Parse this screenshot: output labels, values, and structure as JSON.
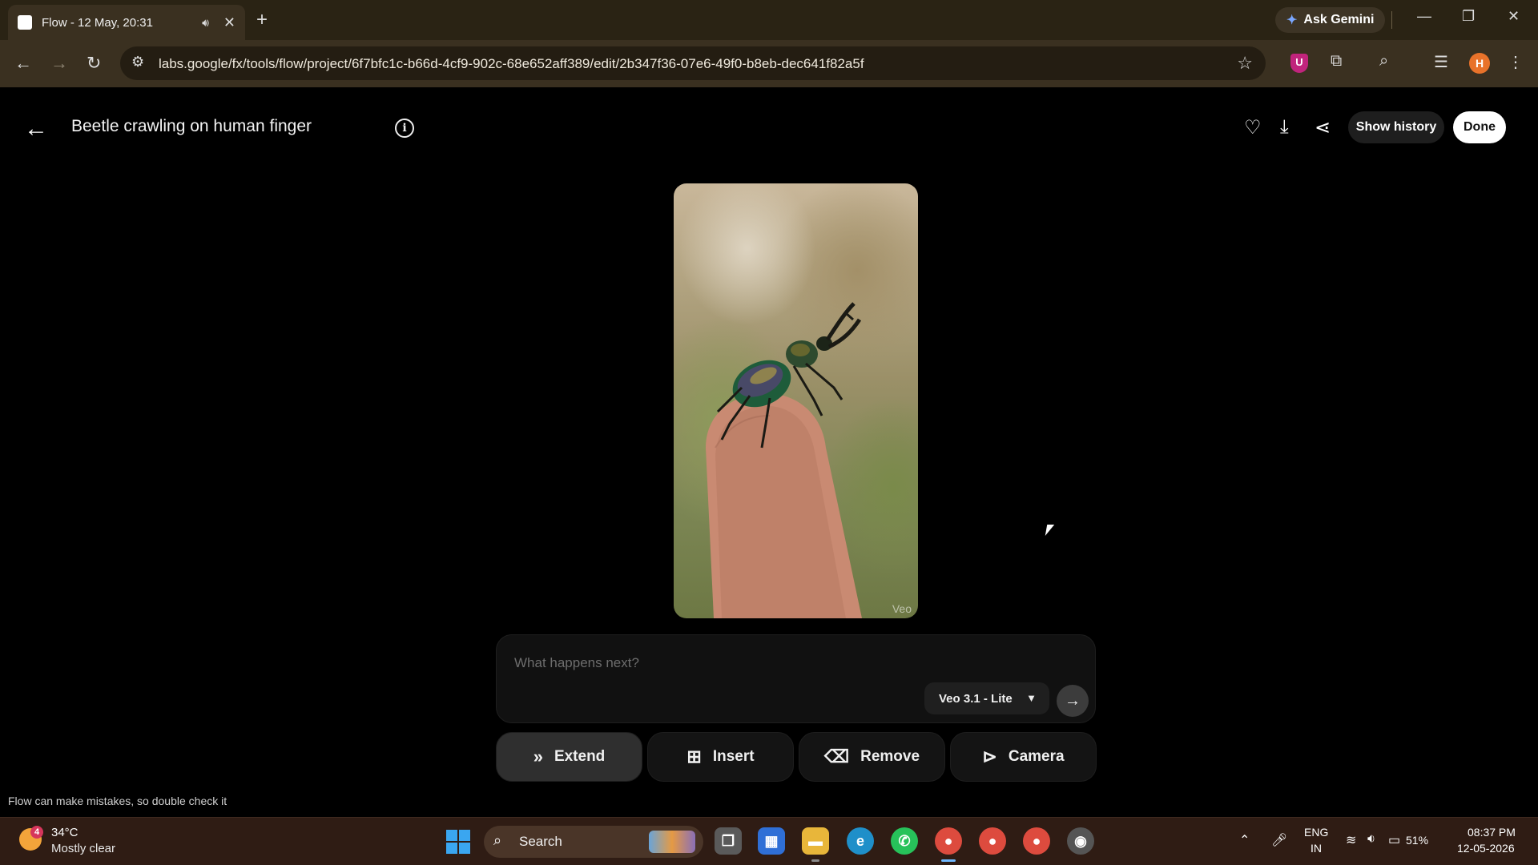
{
  "browser": {
    "tab_title": "Flow - 12 May, 20:31",
    "url": "labs.google/fx/tools/flow/project/6f7bfc1c-b66d-4cf9-902c-68e652aff389/edit/2b347f36-07e6-49f0-b8eb-dec641f82a5f",
    "ask_gemini_label": "Ask Gemini",
    "profile_initial": "H",
    "extension_badge": "U"
  },
  "header": {
    "title": "Beetle crawling on human finger",
    "info_icon": "i",
    "show_history_label": "Show history",
    "done_label": "Done"
  },
  "preview": {
    "watermark": "Veo"
  },
  "prompt": {
    "placeholder": "What happens next?",
    "model": "Veo 3.1 - Lite"
  },
  "actions": [
    {
      "label": "Extend",
      "icon": "double-chevron-right-icon"
    },
    {
      "label": "Insert",
      "icon": "plus-square-icon"
    },
    {
      "label": "Remove",
      "icon": "eraser-icon"
    },
    {
      "label": "Camera",
      "icon": "play-circle-icon"
    }
  ],
  "disclaimer": "Flow can make mistakes, so double check it",
  "taskbar": {
    "weather_badge": "4",
    "temperature": "34°C",
    "condition": "Mostly clear",
    "search_label": "Search",
    "lang_line1": "ENG",
    "lang_line2": "IN",
    "battery": "51%",
    "time": "08:37 PM",
    "date": "12-05-2026"
  },
  "colors": {
    "browser_frame": "#2a2314",
    "app_background": "#000000",
    "done_button": "#ffffff",
    "taskbar": "#2f1c14",
    "profile_avatar": "#e8722a"
  }
}
